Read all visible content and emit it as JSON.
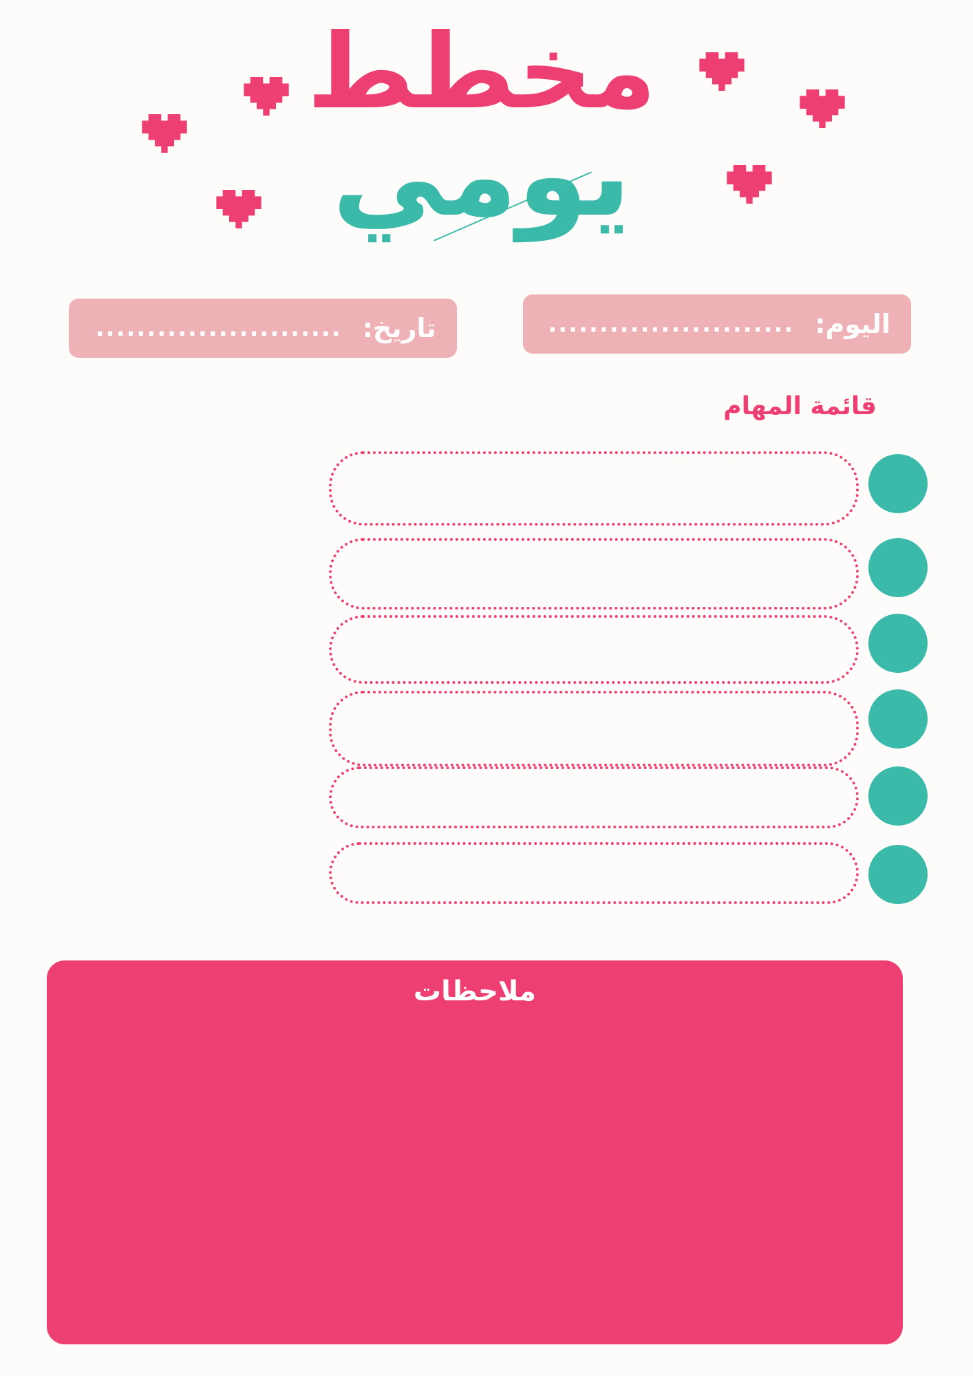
{
  "title": {
    "line1": "مخطط",
    "line2": "يومي"
  },
  "fields": {
    "day_label": "اليوم:",
    "day_placeholder": "........................",
    "date_label": "تاريخ:",
    "date_placeholder": "........................"
  },
  "tasks": {
    "title": "قائمة المهام",
    "items": [
      "",
      "",
      "",
      "",
      "",
      ""
    ]
  },
  "notes": {
    "title": "ملاحظات"
  },
  "colors": {
    "pink": "#ee3f72",
    "teal": "#3cbaa9",
    "light_pink": "#edb1b6",
    "background": "#fdfcfb"
  },
  "icons": [
    "pixel-heart-icon"
  ]
}
